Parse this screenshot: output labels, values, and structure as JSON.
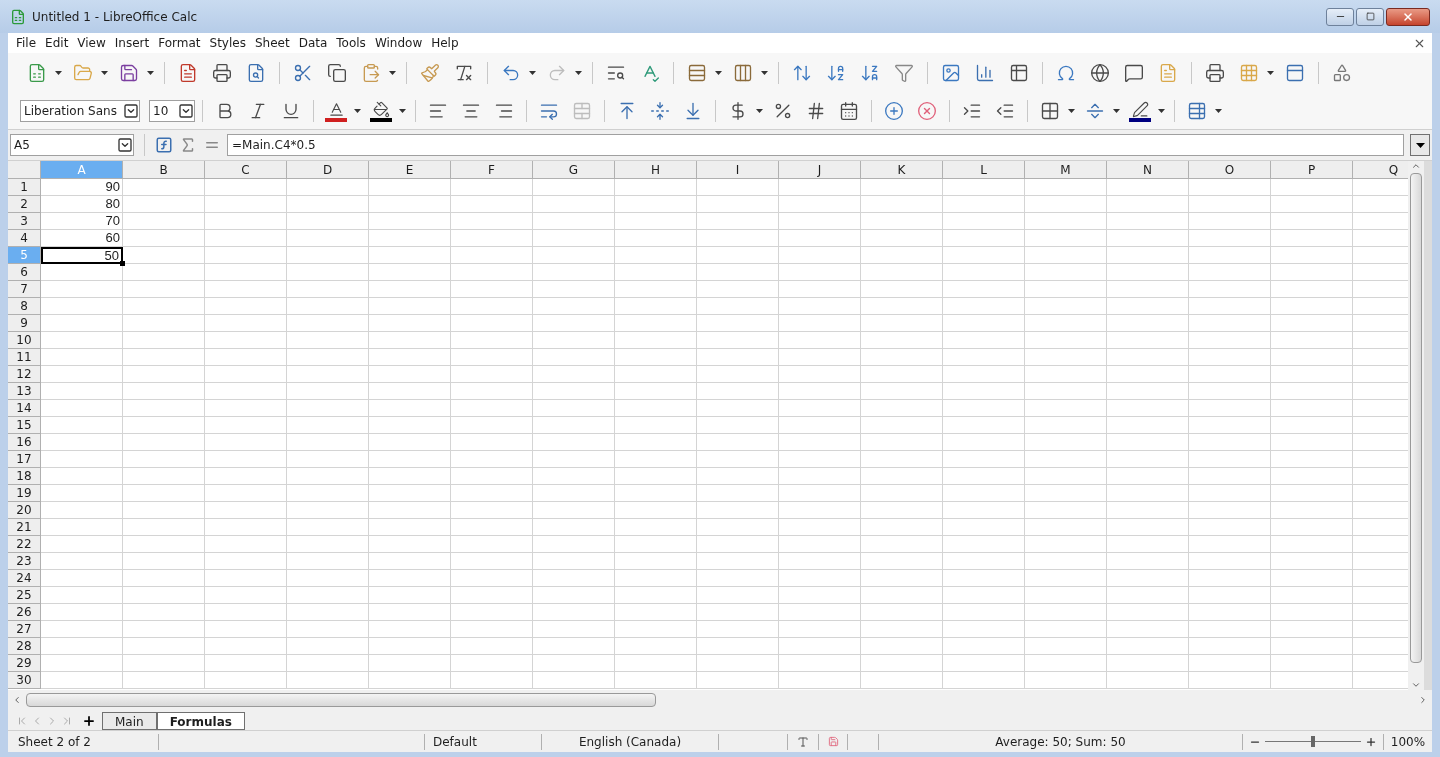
{
  "window": {
    "title": "Untitled 1 - LibreOffice Calc"
  },
  "menu": [
    "File",
    "Edit",
    "View",
    "Insert",
    "Format",
    "Styles",
    "Sheet",
    "Data",
    "Tools",
    "Window",
    "Help"
  ],
  "formatting": {
    "font_name": "Liberation Sans",
    "font_size": "10"
  },
  "formula_bar": {
    "name_box": "A5",
    "formula": "=Main.C4*0.5"
  },
  "columns": [
    {
      "label": "A",
      "selected": true
    },
    {
      "label": "B",
      "selected": false
    },
    {
      "label": "C",
      "selected": false
    },
    {
      "label": "D",
      "selected": false
    },
    {
      "label": "E",
      "selected": false
    },
    {
      "label": "F",
      "selected": false
    },
    {
      "label": "G",
      "selected": false
    },
    {
      "label": "H",
      "selected": false
    },
    {
      "label": "I",
      "selected": false
    },
    {
      "label": "J",
      "selected": false
    },
    {
      "label": "K",
      "selected": false
    },
    {
      "label": "L",
      "selected": false
    },
    {
      "label": "M",
      "selected": false
    },
    {
      "label": "N",
      "selected": false
    },
    {
      "label": "O",
      "selected": false
    },
    {
      "label": "P",
      "selected": false
    },
    {
      "label": "Q",
      "selected": false
    }
  ],
  "rows": [
    {
      "label": "1",
      "selected": false,
      "cells": [
        {
          "value": "90",
          "selected": false
        }
      ]
    },
    {
      "label": "2",
      "selected": false,
      "cells": [
        {
          "value": "80",
          "selected": false
        }
      ]
    },
    {
      "label": "3",
      "selected": false,
      "cells": [
        {
          "value": "70",
          "selected": false
        }
      ]
    },
    {
      "label": "4",
      "selected": false,
      "cells": [
        {
          "value": "60",
          "selected": false
        }
      ]
    },
    {
      "label": "5",
      "selected": true,
      "cells": [
        {
          "value": "50",
          "selected": true
        }
      ]
    },
    {
      "label": "6",
      "selected": false
    },
    {
      "label": "7",
      "selected": false
    },
    {
      "label": "8",
      "selected": false
    },
    {
      "label": "9",
      "selected": false
    },
    {
      "label": "10",
      "selected": false
    },
    {
      "label": "11",
      "selected": false
    },
    {
      "label": "12",
      "selected": false
    },
    {
      "label": "13",
      "selected": false
    },
    {
      "label": "14",
      "selected": false
    },
    {
      "label": "15",
      "selected": false
    },
    {
      "label": "16",
      "selected": false
    },
    {
      "label": "17",
      "selected": false
    },
    {
      "label": "18",
      "selected": false
    },
    {
      "label": "19",
      "selected": false
    },
    {
      "label": "20",
      "selected": false
    },
    {
      "label": "21",
      "selected": false
    },
    {
      "label": "22",
      "selected": false
    },
    {
      "label": "23",
      "selected": false
    },
    {
      "label": "24",
      "selected": false
    },
    {
      "label": "25",
      "selected": false
    },
    {
      "label": "26",
      "selected": false
    },
    {
      "label": "27",
      "selected": false
    },
    {
      "label": "28",
      "selected": false
    },
    {
      "label": "29",
      "selected": false
    },
    {
      "label": "30",
      "selected": false
    }
  ],
  "sheet_tabs": [
    {
      "label": "Main",
      "selected": false
    },
    {
      "label": "Formulas",
      "selected": true
    }
  ],
  "status_bar": {
    "sheet": "Sheet 2 of 2",
    "page_style": "Default",
    "language": "English (Canada)",
    "selection_stats": "Average: 50; Sum: 50",
    "zoom_slider": {
      "level": 0.5
    },
    "zoom": "100%"
  }
}
